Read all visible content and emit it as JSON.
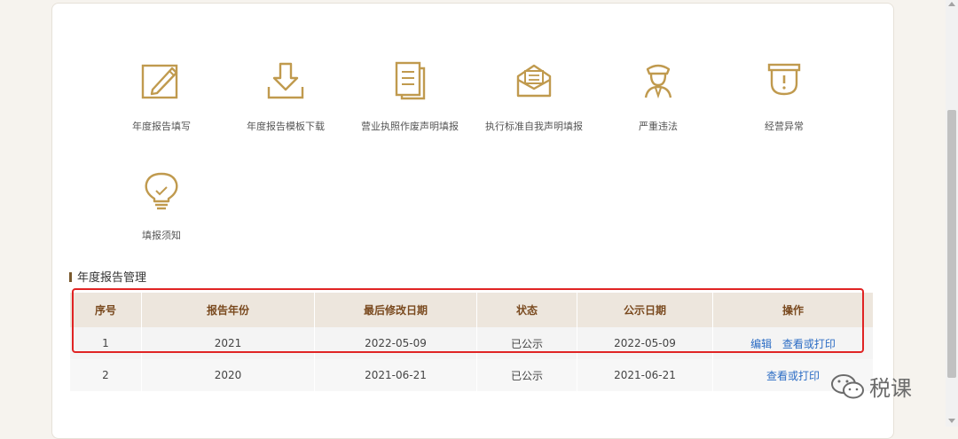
{
  "icons": [
    {
      "label": "年度报告填写",
      "icon": "edit-form-icon"
    },
    {
      "label": "年度报告模板下载",
      "icon": "download-icon"
    },
    {
      "label": "营业执照作废声明填报",
      "icon": "document-icon"
    },
    {
      "label": "执行标准自我声明填报",
      "icon": "envelope-icon"
    },
    {
      "label": "严重违法",
      "icon": "officer-icon"
    },
    {
      "label": "经营异常",
      "icon": "warning-shield-icon"
    },
    {
      "label": "填报须知",
      "icon": "lightbulb-icon"
    }
  ],
  "section": {
    "title": "年度报告管理"
  },
  "table": {
    "headers": [
      "序号",
      "报告年份",
      "最后修改日期",
      "状态",
      "公示日期",
      "操作"
    ],
    "rows": [
      {
        "index": "1",
        "year": "2021",
        "modified": "2022-05-09",
        "status": "已公示",
        "publish": "2022-05-09",
        "actions": [
          "编辑",
          "查看或打印"
        ]
      },
      {
        "index": "2",
        "year": "2020",
        "modified": "2021-06-21",
        "status": "已公示",
        "publish": "2021-06-21",
        "actions": [
          "查看或打印"
        ]
      }
    ]
  },
  "watermark": {
    "text": "税课"
  },
  "colors": {
    "accent": "#c09a4e",
    "header_bg": "#ede6dd",
    "link": "#2b6cc4",
    "highlight": "#e02424"
  }
}
